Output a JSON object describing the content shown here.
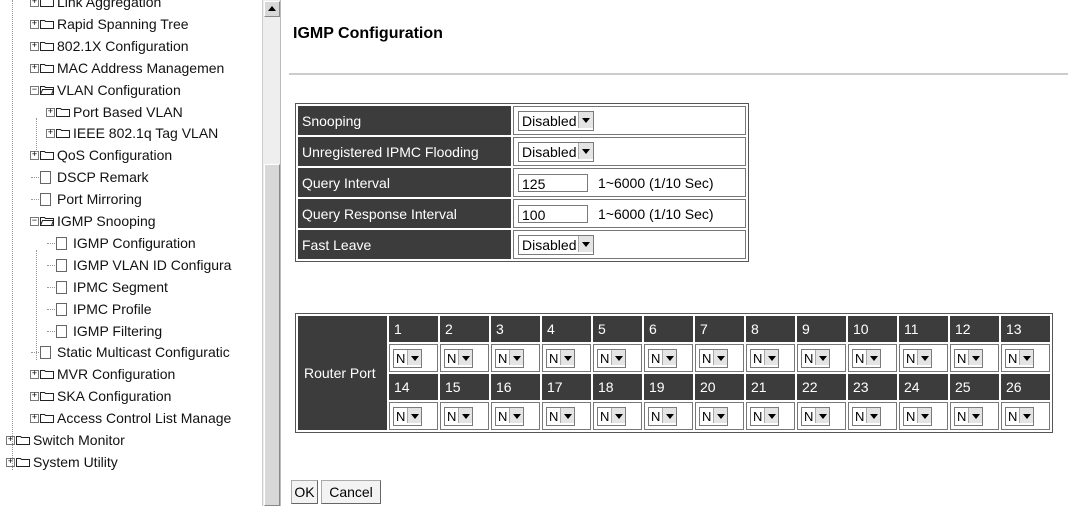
{
  "tree": {
    "items": [
      {
        "label": "Link Aggregation",
        "type": "folder",
        "level": 1,
        "expanded": false
      },
      {
        "label": "Rapid Spanning Tree",
        "type": "folder",
        "level": 1,
        "expanded": false
      },
      {
        "label": "802.1X Configuration",
        "type": "folder",
        "level": 1,
        "expanded": false
      },
      {
        "label": "MAC Address Managemen",
        "type": "folder",
        "level": 1,
        "expanded": false
      },
      {
        "label": "VLAN Configuration",
        "type": "folder",
        "level": 1,
        "expanded": true
      },
      {
        "label": "Port Based VLAN",
        "type": "folder",
        "level": 2,
        "expanded": false
      },
      {
        "label": "IEEE 802.1q Tag VLAN",
        "type": "folder",
        "level": 2,
        "expanded": false
      },
      {
        "label": "QoS Configuration",
        "type": "folder",
        "level": 1,
        "expanded": false
      },
      {
        "label": "DSCP Remark",
        "type": "page",
        "level": 1
      },
      {
        "label": "Port Mirroring",
        "type": "page",
        "level": 1
      },
      {
        "label": "IGMP Snooping",
        "type": "folder",
        "level": 1,
        "expanded": true
      },
      {
        "label": "IGMP Configuration",
        "type": "page",
        "level": 2
      },
      {
        "label": "IGMP VLAN ID Configura",
        "type": "page",
        "level": 2
      },
      {
        "label": "IPMC Segment",
        "type": "page",
        "level": 2
      },
      {
        "label": "IPMC Profile",
        "type": "page",
        "level": 2
      },
      {
        "label": "IGMP Filtering",
        "type": "page",
        "level": 2
      },
      {
        "label": "Static Multicast Configuratic",
        "type": "page",
        "level": 1
      },
      {
        "label": "MVR Configuration",
        "type": "folder",
        "level": 1,
        "expanded": false
      },
      {
        "label": "SKA Configuration",
        "type": "folder",
        "level": 1,
        "expanded": false
      },
      {
        "label": "Access Control List Manage",
        "type": "folder",
        "level": 1,
        "expanded": false
      },
      {
        "label": "Switch Monitor",
        "type": "folder",
        "level": 0,
        "expanded": false
      },
      {
        "label": "System Utility",
        "type": "folder",
        "level": 0,
        "expanded": false
      }
    ]
  },
  "page": {
    "title": "IGMP Configuration"
  },
  "settings": {
    "snooping": {
      "label": "Snooping",
      "value": "Disabled"
    },
    "unregistered_flooding": {
      "label": "Unregistered IPMC Flooding",
      "value": "Disabled"
    },
    "query_interval": {
      "label": "Query Interval",
      "value": "125",
      "range": "1~6000 (1/10 Sec)"
    },
    "query_response_interval": {
      "label": "Query Response Interval",
      "value": "100",
      "range": "1~6000 (1/10 Sec)"
    },
    "fast_leave": {
      "label": "Fast Leave",
      "value": "Disabled"
    }
  },
  "router_port": {
    "label": "Router Port",
    "rows": [
      {
        "ports": [
          "1",
          "2",
          "3",
          "4",
          "5",
          "6",
          "7",
          "8",
          "9",
          "10",
          "11",
          "12",
          "13"
        ],
        "values": [
          "N",
          "N",
          "N",
          "N",
          "N",
          "N",
          "N",
          "N",
          "N",
          "N",
          "N",
          "N",
          "N"
        ]
      },
      {
        "ports": [
          "14",
          "15",
          "16",
          "17",
          "18",
          "19",
          "20",
          "21",
          "22",
          "23",
          "24",
          "25",
          "26"
        ],
        "values": [
          "N",
          "N",
          "N",
          "N",
          "N",
          "N",
          "N",
          "N",
          "N",
          "N",
          "N",
          "N",
          "N"
        ]
      }
    ]
  },
  "buttons": {
    "ok": "OK",
    "cancel": "Cancel"
  }
}
